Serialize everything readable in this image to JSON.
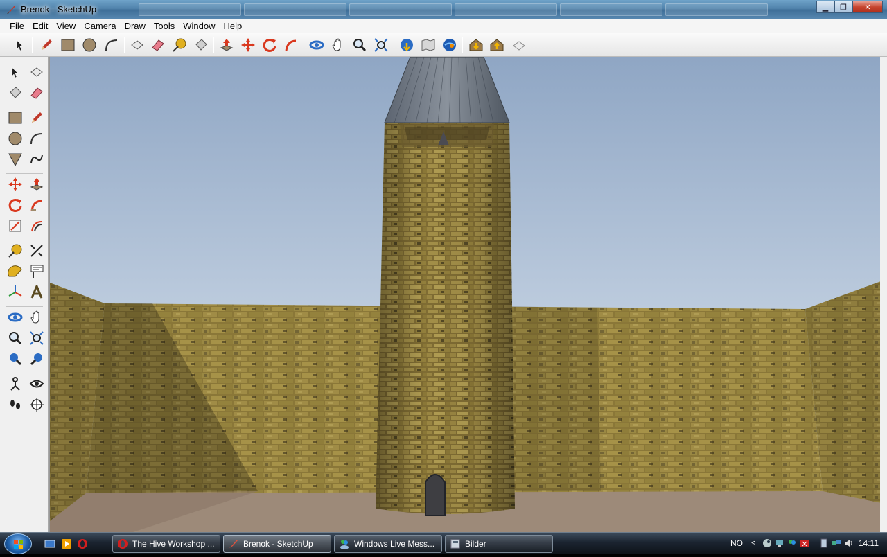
{
  "window": {
    "title": "Brenok - SketchUp"
  },
  "menu": {
    "items": [
      "File",
      "Edit",
      "View",
      "Camera",
      "Draw",
      "Tools",
      "Window",
      "Help"
    ]
  },
  "toolbar": {
    "tools": [
      "select-tool",
      "line-tool",
      "rectangle-tool",
      "circle-tool",
      "arc-tool",
      "make-component-tool",
      "eraser-tool",
      "tape-measure-tool",
      "paint-bucket-tool",
      "push-pull-tool",
      "move-tool",
      "rotate-tool",
      "follow-me-tool",
      "orbit-tool",
      "pan-tool",
      "zoom-tool",
      "zoom-extents-tool",
      "get-models-tool",
      "share-model-tool",
      "google-earth-tool",
      "get-current-view-tool",
      "toggle-terrain-tool",
      "place-model-tool"
    ]
  },
  "left_toolbar": {
    "tools": [
      "select-tool",
      "make-component-tool",
      "paint-bucket-tool",
      "eraser-tool",
      "rectangle-tool",
      "line-tool",
      "circle-tool",
      "arc-tool",
      "polygon-tool",
      "freehand-tool",
      "move-tool",
      "push-pull-tool",
      "rotate-tool",
      "follow-me-tool",
      "scale-tool",
      "offset-tool",
      "tape-measure-tool",
      "dimension-tool",
      "protractor-tool",
      "text-tool",
      "axes-tool",
      "3d-text-tool",
      "orbit-tool",
      "pan-tool",
      "zoom-tool",
      "zoom-window-tool",
      "previous-view-tool",
      "next-view-tool",
      "position-camera-tool",
      "look-around-tool",
      "walk-tool",
      "section-plane-tool"
    ]
  },
  "taskbar": {
    "tasks": [
      {
        "label": "The Hive Workshop ...",
        "icon": "opera-icon"
      },
      {
        "label": "Brenok - SketchUp",
        "icon": "sketchup-icon",
        "active": true
      },
      {
        "label": "Windows Live Mess...",
        "icon": "messenger-icon"
      },
      {
        "label": "Bilder",
        "icon": "folder-icon"
      }
    ],
    "language": "NO",
    "clock": "14:11"
  },
  "colors": {
    "sky_top": "#8fa6c4",
    "sky_bottom": "#e4ecf4",
    "ground": "#9c8878",
    "brick": "#8c7a3a"
  }
}
